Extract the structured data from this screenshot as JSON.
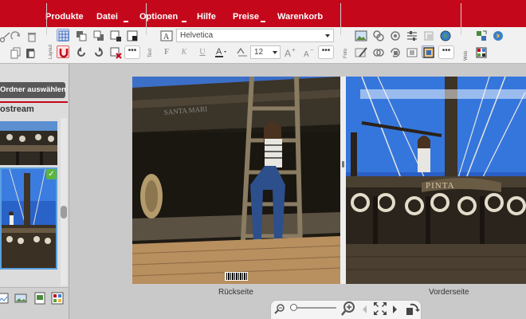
{
  "menu": {
    "items": [
      "Produkte",
      "Datei",
      "Optionen",
      "Hilfe",
      "Preise",
      "Warenkorb"
    ]
  },
  "toolbar": {
    "section_labels": {
      "layout": "Layout",
      "text": "Text",
      "foto": "Foto",
      "web": "Web"
    },
    "font_family": "Helvetica",
    "font_size": "12",
    "bold_label": "F",
    "italic_label": "K",
    "underline_label": "U",
    "more_label": "•••"
  },
  "sidebar": {
    "folder_button": "Ordner auswählen",
    "stream_title": "ostream"
  },
  "pages": {
    "back_label": "Rückseite",
    "front_label": "Vorderseite"
  },
  "colors": {
    "brand_red": "#c5071b",
    "toolbar_bg": "#f1f1f1",
    "workspace_bg": "#c9c9c9",
    "selected_check": "#5db53f"
  },
  "icons": {
    "zoom_out": "zoom-out-icon",
    "zoom_in": "zoom-in-icon",
    "fullscreen": "fullscreen-icon",
    "prev": "prev-arrow-icon",
    "next": "next-arrow-icon",
    "rotate": "rotate-icon"
  }
}
